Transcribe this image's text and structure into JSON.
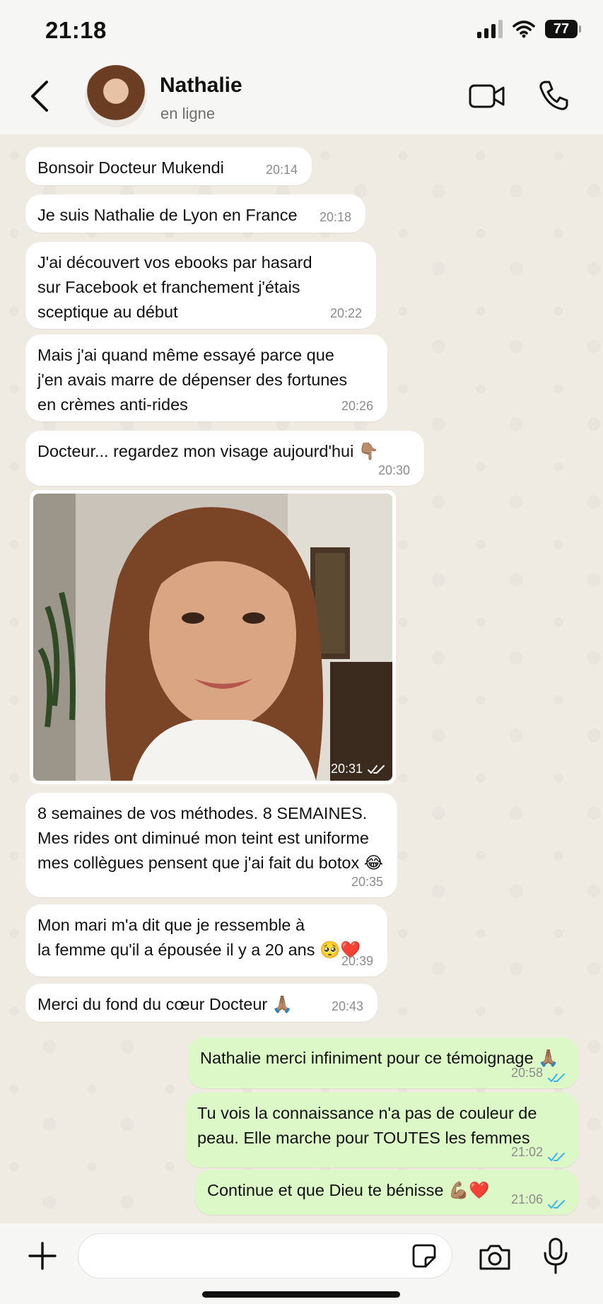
{
  "status_bar": {
    "time": "21:18",
    "battery": "77"
  },
  "header": {
    "contact_name": "Nathalie",
    "contact_status": "en ligne"
  },
  "messages": [
    {
      "direction": "in",
      "text": "Bonsoir Docteur Mukendi",
      "time": "20:14"
    },
    {
      "direction": "in",
      "text": "Je suis Nathalie de Lyon en France",
      "time": "20:18"
    },
    {
      "direction": "in",
      "text": "J'ai découvert vos ebooks par hasard\nsur Facebook et franchement j'étais\nsceptique au début",
      "time": "20:22"
    },
    {
      "direction": "in",
      "text": "Mais j'ai quand même essayé parce que\nj'en avais marre de dépenser des fortunes\nen crèmes anti-rides",
      "time": "20:26"
    },
    {
      "direction": "in",
      "text": "Docteur... regardez mon visage aujourd'hui 👇🏽",
      "time": "20:30"
    },
    {
      "direction": "in",
      "type": "image",
      "time": "20:31"
    },
    {
      "direction": "in",
      "text": "8 semaines de vos méthodes. 8 SEMAINES.\nMes rides ont diminué mon teint est uniforme\nmes collègues pensent que j'ai fait du botox 😂",
      "time": "20:35"
    },
    {
      "direction": "in",
      "text": "Mon mari m'a dit que je ressemble à\nla femme qu'il a épousée il y a 20 ans 🥺❤️",
      "time": "20:39"
    },
    {
      "direction": "in",
      "text": "Merci du fond du cœur Docteur 🙏🏽",
      "time": "20:43"
    },
    {
      "direction": "out",
      "text": "Nathalie merci infiniment pour ce témoignage 🙏🏽",
      "time": "20:58"
    },
    {
      "direction": "out",
      "text": "Tu vois la connaissance n'a pas de couleur de\npeau. Elle marche pour TOUTES les femmes",
      "time": "21:02"
    },
    {
      "direction": "out",
      "text": "Continue et que Dieu te bénisse 💪🏽❤️",
      "time": "21:06"
    }
  ],
  "input": {
    "placeholder": ""
  },
  "colors": {
    "incoming_bubble": "#ffffff",
    "outgoing_bubble": "#dcf8c6",
    "read_ticks": "#34b7f1",
    "chat_background": "#efeae2"
  },
  "icons": [
    "back-arrow-icon",
    "video-call-icon",
    "phone-icon",
    "plus-icon",
    "sticker-icon",
    "camera-icon",
    "microphone-icon",
    "double-check-icon",
    "signal-icon",
    "wifi-icon",
    "battery-icon"
  ]
}
